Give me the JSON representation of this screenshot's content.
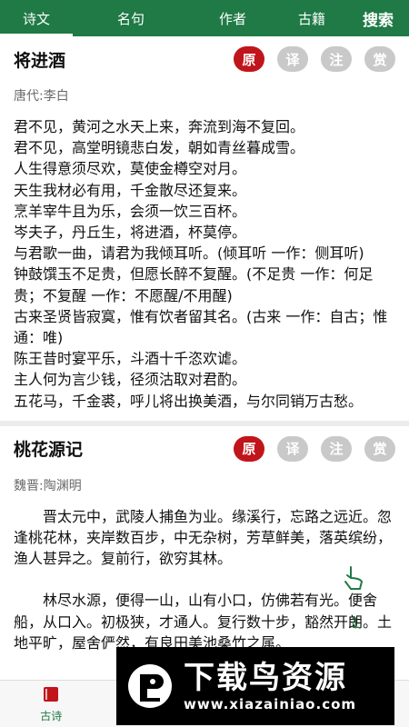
{
  "nav": {
    "tabs": [
      {
        "label": "诗文"
      },
      {
        "label": "名句"
      },
      {
        "label": "作者"
      },
      {
        "label": "古籍"
      },
      {
        "label": "搜索"
      }
    ]
  },
  "actions": [
    "原",
    "译",
    "注",
    "赏"
  ],
  "poems": [
    {
      "title": "将进酒",
      "author": "唐代:李白",
      "lines": [
        "君不见，黄河之水天上来，奔流到海不复回。",
        "君不见，高堂明镜悲白发，朝如青丝暮成雪。",
        "人生得意须尽欢，莫使金樽空对月。",
        "天生我材必有用，千金散尽还复来。",
        "烹羊宰牛且为乐，会须一饮三百杯。",
        "岑夫子，丹丘生，将进酒，杯莫停。",
        "与君歌一曲，请君为我倾耳听。(倾耳听 一作：侧耳听)",
        "钟鼓馔玉不足贵，但愿长醉不复醒。(不足贵 一作：何足贵；不复醒 一作：不愿醒/不用醒)",
        "古来圣贤皆寂寞，惟有饮者留其名。(古来 一作：自古；惟 通：唯)",
        "陈王昔时宴平乐，斗酒十千恣欢谑。",
        "主人何为言少钱，径须沽取对君酌。",
        "五花马，千金裘，呼儿将出换美酒，与尔同销万古愁。"
      ]
    },
    {
      "title": "桃花源记",
      "author": "魏晋:陶渊明",
      "paragraphs": [
        "晋太元中，武陵人捕鱼为业。缘溪行，忘路之远近。忽逢桃花林，夹岸数百步，中无杂树，芳草鲜美，落英缤纷，渔人甚异之。复前行，欲穷其林。",
        "林尽水源，便得一山，山有小口，仿佛若有光。便舍船，从口入。初极狭，才通人。复行数十步，豁然开朗。土地平旷，屋舍俨然，有良田美池桑竹之属。"
      ]
    }
  ],
  "page_indicator": "1",
  "bottom": {
    "tabs": [
      {
        "label": "古诗"
      },
      {
        "label": ""
      },
      {
        "label": ""
      },
      {
        "label": ""
      }
    ]
  },
  "watermark": {
    "cn": "下载鸟资源",
    "url": "www.xiazainiao.com"
  },
  "colors": {
    "brand": "#1f7a46",
    "active_action": "#c0151b",
    "inactive_action": "#c9c9c9"
  }
}
